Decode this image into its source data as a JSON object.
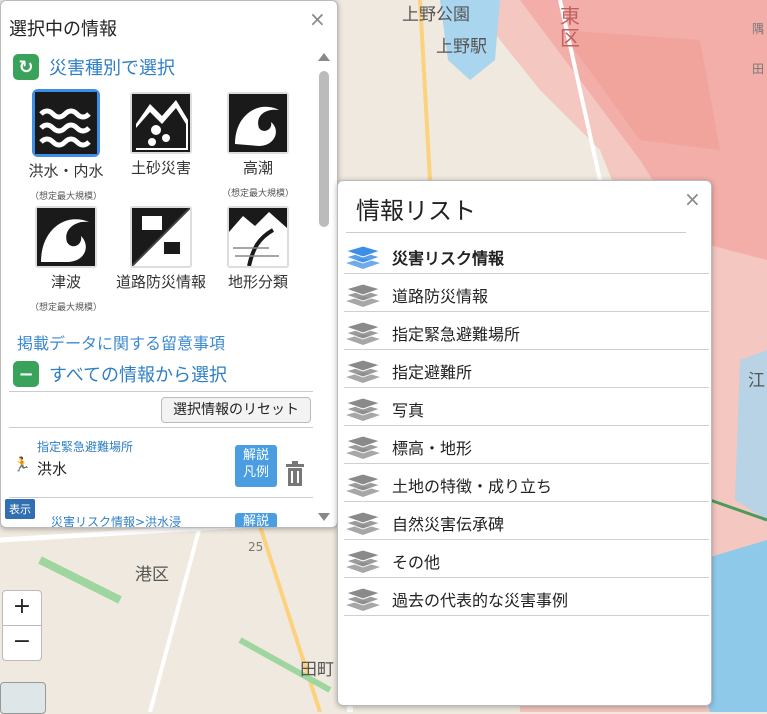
{
  "map": {
    "labels": [
      {
        "id": "ueno-park",
        "text": "上野公園"
      },
      {
        "id": "ueno-station",
        "text": "上野駅"
      },
      {
        "id": "ward-east-1",
        "text": "東"
      },
      {
        "id": "ward-east-2",
        "text": "区"
      },
      {
        "id": "minato-ku",
        "text": "港区"
      },
      {
        "id": "tamachi",
        "text": "田町"
      },
      {
        "id": "route-25",
        "text": "25"
      },
      {
        "id": "east-edge",
        "text": "江"
      },
      {
        "id": "east-edge-2",
        "text": "隅"
      },
      {
        "id": "east-edge-3",
        "text": "田"
      }
    ]
  },
  "left_panel": {
    "title": "選択中の情報",
    "close": "×",
    "section1": {
      "icon": "back-arrow-icon",
      "label": "災害種別で選択"
    },
    "hazards": [
      {
        "id": "flood",
        "label": "洪水・内水",
        "note": "（想定最大規模）",
        "selected": true
      },
      {
        "id": "landslide",
        "label": "土砂災害",
        "note": "",
        "selected": false
      },
      {
        "id": "storm-surge",
        "label": "高潮",
        "note": "（想定最大規模）",
        "selected": false
      },
      {
        "id": "tsunami",
        "label": "津波",
        "note": "（想定最大規模）",
        "selected": false
      },
      {
        "id": "road",
        "label": "道路防災情報",
        "note": "",
        "selected": false
      },
      {
        "id": "terrain",
        "label": "地形分類",
        "note": "",
        "selected": false
      }
    ],
    "notice_link": "掲載データに関する留意事項",
    "section2": {
      "icon": "minus-icon",
      "label": "すべての情報から選択"
    },
    "reset_button": "選択情報のリセット",
    "selected_items": [
      {
        "category": "指定緊急避難場所",
        "name": "洪水",
        "legend_button": [
          "解説",
          "凡例"
        ]
      },
      {
        "category": "災害リスク情報>洪水浸",
        "legend_button": [
          "解説"
        ]
      }
    ],
    "show_badge": "表示"
  },
  "right_panel": {
    "title": "情報リスト",
    "close": "×",
    "items": [
      {
        "label": "災害リスク情報",
        "active": true
      },
      {
        "label": "道路防災情報",
        "active": false
      },
      {
        "label": "指定緊急避難場所",
        "active": false
      },
      {
        "label": "指定避難所",
        "active": false
      },
      {
        "label": "写真",
        "active": false
      },
      {
        "label": "標高・地形",
        "active": false
      },
      {
        "label": "土地の特徴・成り立ち",
        "active": false
      },
      {
        "label": "自然災害伝承碑",
        "active": false
      },
      {
        "label": "その他",
        "active": false
      },
      {
        "label": "過去の代表的な災害事例",
        "active": false
      }
    ]
  },
  "zoom": {
    "in": "+",
    "out": "−"
  },
  "colors": {
    "accent_blue": "#3d8ee6",
    "section_green": "#3aa35b",
    "link_blue": "#3c8ad0",
    "layer_active": "#3d8ee6",
    "layer_inactive": "#8a8a8a"
  }
}
